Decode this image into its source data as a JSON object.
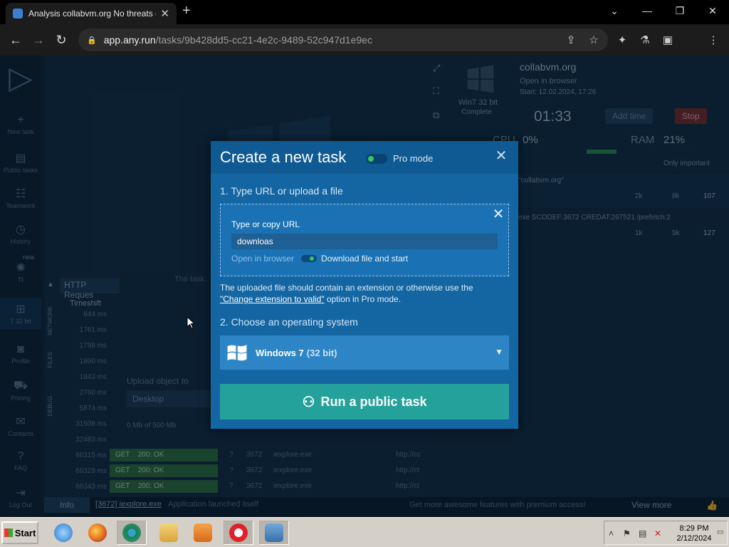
{
  "browser": {
    "tab_title": "Analysis collabvm.org No threats de",
    "url_host": "app.any.run",
    "url_path": "/tasks/9b428dd5-cc21-4e2c-9489-52c947d1e9ec"
  },
  "sidebar": {
    "items": [
      {
        "label": "New task"
      },
      {
        "label": "Public tasks"
      },
      {
        "label": "Teamwork"
      },
      {
        "label": "History"
      },
      {
        "label": "TI",
        "badge": "new"
      },
      {
        "label": "7 32 bit"
      },
      {
        "label": "Profile"
      },
      {
        "label": "Pricing"
      },
      {
        "label": "Contacts"
      },
      {
        "label": "FAQ"
      },
      {
        "label": "Log Out"
      }
    ]
  },
  "background": {
    "http_requests_tab": "HTTP Reques",
    "timeshift_header": "Timeshift",
    "vtabs": [
      "NETWORK",
      "FILES",
      "DEBUG"
    ],
    "timeshifts": [
      "844 ms",
      "1761 ms",
      "1798 ms",
      "1800 ms",
      "1843 ms",
      "2760 ms",
      "5874 ms",
      "31508 ms",
      "32483 ms",
      "66315 ms",
      "66329 ms",
      "66343 ms"
    ],
    "requests": [
      {
        "method": "GET",
        "status": "200: OK",
        "q": "?",
        "pid": "3672",
        "process": "iexplore.exe",
        "url": "http://cc"
      },
      {
        "method": "GET",
        "status": "200: OK",
        "q": "?",
        "pid": "3672",
        "process": "iexplore.exe",
        "url": "http://ct"
      },
      {
        "method": "GET",
        "status": "200: OK",
        "q": "?",
        "pid": "3672",
        "process": "iexplore.exe",
        "url": "http://ct"
      }
    ],
    "upload_label": "Upload object to",
    "upload_target": "Desktop",
    "upload_size": "0 Mb of 500 Mb",
    "vm_text": "The task",
    "right": {
      "os_label": "Win7 32 bit",
      "os_sub": "Complete",
      "task_name": "collabvm.org",
      "open_in_browser": "Open in browser",
      "start": "Start: 12.02.2024, 17:26",
      "timer": "01:33",
      "add_time": "Add time",
      "stop": "Stop",
      "cpu_label": "CPU",
      "cpu_value": "0%",
      "ram_label": "RAM",
      "ram_value": "21%",
      "only_important": "Only important",
      "proc1_name": "\"collabvm.org\"",
      "proc1_stats": [
        "2k",
        "8k",
        "107"
      ],
      "proc2_name": "exe  SCODEF:3672 CREDAT:267521 /prefetch:2",
      "proc2_stats": [
        "1k",
        "5k",
        "127"
      ]
    },
    "bottom": {
      "info_tab": "Info",
      "event_process": "[3672] iexplore.exe",
      "event_text": "Application launched itself",
      "premium_text": "Get more awesome features with premium access!",
      "view_more": "View more"
    }
  },
  "modal": {
    "title": "Create a new task",
    "pro_mode_label": "Pro mode",
    "step1": "1. Type URL or upload a file",
    "url_label": "Type or copy URL",
    "url_value": "downloas",
    "open_in_browser": "Open in browser",
    "download_and_start": "Download file and start",
    "note_part1": "The uploaded file should contain an extension or otherwise use the",
    "note_link": "\"Change extension to valid\"",
    "note_part2": " option in Pro mode.",
    "step2": "2. Choose an operating system",
    "os_name": "Windows 7",
    "os_bits": "(32 bit)",
    "run_button": "Run a public task"
  },
  "taskbar": {
    "start_label": "Start",
    "time": "8:29 PM",
    "date": "2/12/2024",
    "apps": [
      "internet-explorer",
      "firefox",
      "chrome",
      "file-explorer",
      "media-player",
      "opera",
      "control-panel"
    ]
  }
}
